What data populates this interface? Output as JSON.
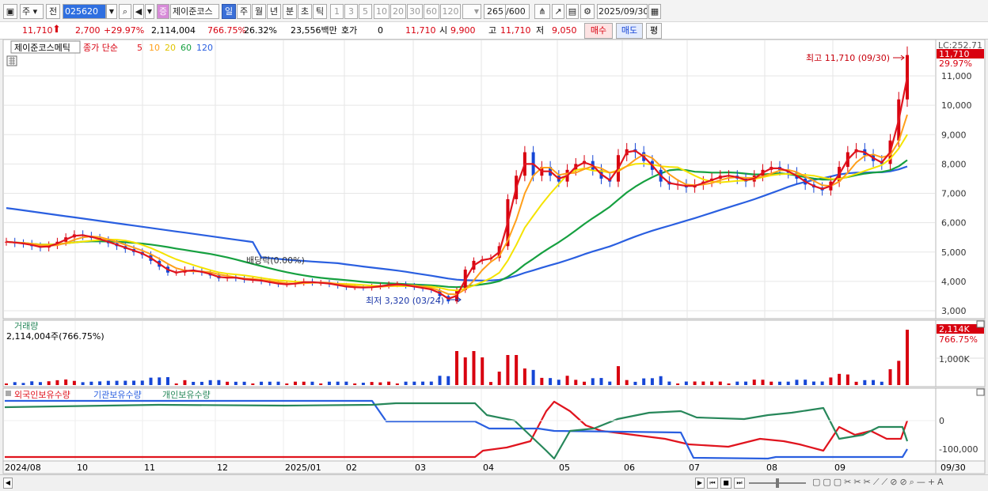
{
  "toolbar": {
    "type_label": "주",
    "prev_label": "전",
    "stock_code": "025620",
    "stock_name": "제이준코스",
    "badge": "증",
    "periods": [
      "일",
      "주",
      "월",
      "년",
      "분",
      "초",
      "틱"
    ],
    "selected_period": "일",
    "steps": [
      "1",
      "3",
      "5",
      "10",
      "20",
      "30",
      "60",
      "120"
    ],
    "count_value": "265",
    "count_total": "/600",
    "date": "2025/09/30"
  },
  "quote": {
    "price": "11,710",
    "change": "2,700",
    "change_pct": "+29.97%",
    "volume": "2,114,004",
    "volume_pct": "766.75%",
    "turnover": "26.32%",
    "amount": "23,556백만",
    "hoga_label": "호가",
    "hoga_value": "0",
    "hoga_price": "11,710",
    "open_label": "시",
    "open_value": "9,900",
    "high_label": "고",
    "high_value": "11,710",
    "low_label": "저",
    "low_value": "9,050",
    "buy_label": "매수",
    "sell_label": "매도",
    "avg_label": "평"
  },
  "price_panel": {
    "legend_name": "제이준코스메틱",
    "legend_ma": "종가 단순",
    "ma_periods": [
      "5",
      "10",
      "20",
      "60",
      "120"
    ],
    "ma_colors": [
      "#e0141e",
      "#ff9f1a",
      "#f5e300",
      "#16a040",
      "#2a5fe0"
    ],
    "top_label": "LC:252.71",
    "last_price_tag": "11,710",
    "last_pct_tag": "29.97%",
    "high_annotation": "최고 11,710 (09/30)",
    "low_annotation": "최저 3,320 (03/24)",
    "dividend_annotation": "배당락(0.00%)",
    "y_ticks": [
      "11,000",
      "10,000",
      "9,000",
      "8,000",
      "7,000",
      "6,000",
      "5,000",
      "4,000",
      "3,000"
    ]
  },
  "volume_panel": {
    "title": "거래량",
    "info": "2,114,004주(766.75%)",
    "tag_value": "2,114K",
    "tag_pct": "766.75%",
    "y_tick": "1,000K"
  },
  "holdings_panel": {
    "series": [
      "외국인보유수량",
      "기관보유수량",
      "개인보유수량"
    ],
    "series_colors": [
      "#e0141e",
      "#2a5fe0",
      "#27875a"
    ],
    "y_ticks": [
      "0",
      "-100,000"
    ]
  },
  "x_axis": {
    "labels": [
      "2024/08",
      "10",
      "11",
      "12",
      "2025/01",
      "02",
      "03",
      "04",
      "05",
      "06",
      "07",
      "08",
      "09"
    ],
    "right_label": "09/30"
  },
  "chart_data": {
    "type": "line",
    "title": "제이준코스메틱",
    "price_range": [
      3000,
      11700
    ],
    "close": [
      5350,
      5300,
      5280,
      5200,
      5150,
      5230,
      5350,
      5500,
      5600,
      5550,
      5480,
      5400,
      5300,
      5200,
      5100,
      5000,
      4900,
      4700,
      4500,
      4300,
      4300,
      4400,
      4350,
      4300,
      4200,
      4100,
      4150,
      4100,
      4050,
      4050,
      4000,
      3950,
      3900,
      3900,
      3950,
      4000,
      3950,
      3950,
      3900,
      3850,
      3800,
      3800,
      3780,
      3820,
      3850,
      3900,
      3900,
      3850,
      3800,
      3750,
      3700,
      3500,
      3320,
      3700,
      4400,
      4700,
      4750,
      4800,
      5200,
      6800,
      7600,
      8400,
      7600,
      7900,
      7600,
      7400,
      7800,
      8000,
      8100,
      7800,
      7500,
      7400,
      8300,
      8500,
      8400,
      8100,
      7800,
      7400,
      7300,
      7300,
      7200,
      7300,
      7400,
      7500,
      7600,
      7600,
      7500,
      7400,
      7600,
      7800,
      7900,
      7800,
      7700,
      7500,
      7300,
      7200,
      7100,
      7400,
      7900,
      8400,
      8500,
      8300,
      8100,
      8000,
      8800,
      10200,
      11710
    ],
    "series": [
      {
        "name": "외국인보유수량",
        "trend": "flat low until 04, then rises to peak in 05, falls, ends near 0"
      },
      {
        "name": "기관보유수량",
        "trend": "high until 02, steps down through 04 and 07, minimum from 07 to 09/30"
      },
      {
        "name": "개인보유수량",
        "trend": "gradually rising, volatile after 04"
      }
    ]
  }
}
